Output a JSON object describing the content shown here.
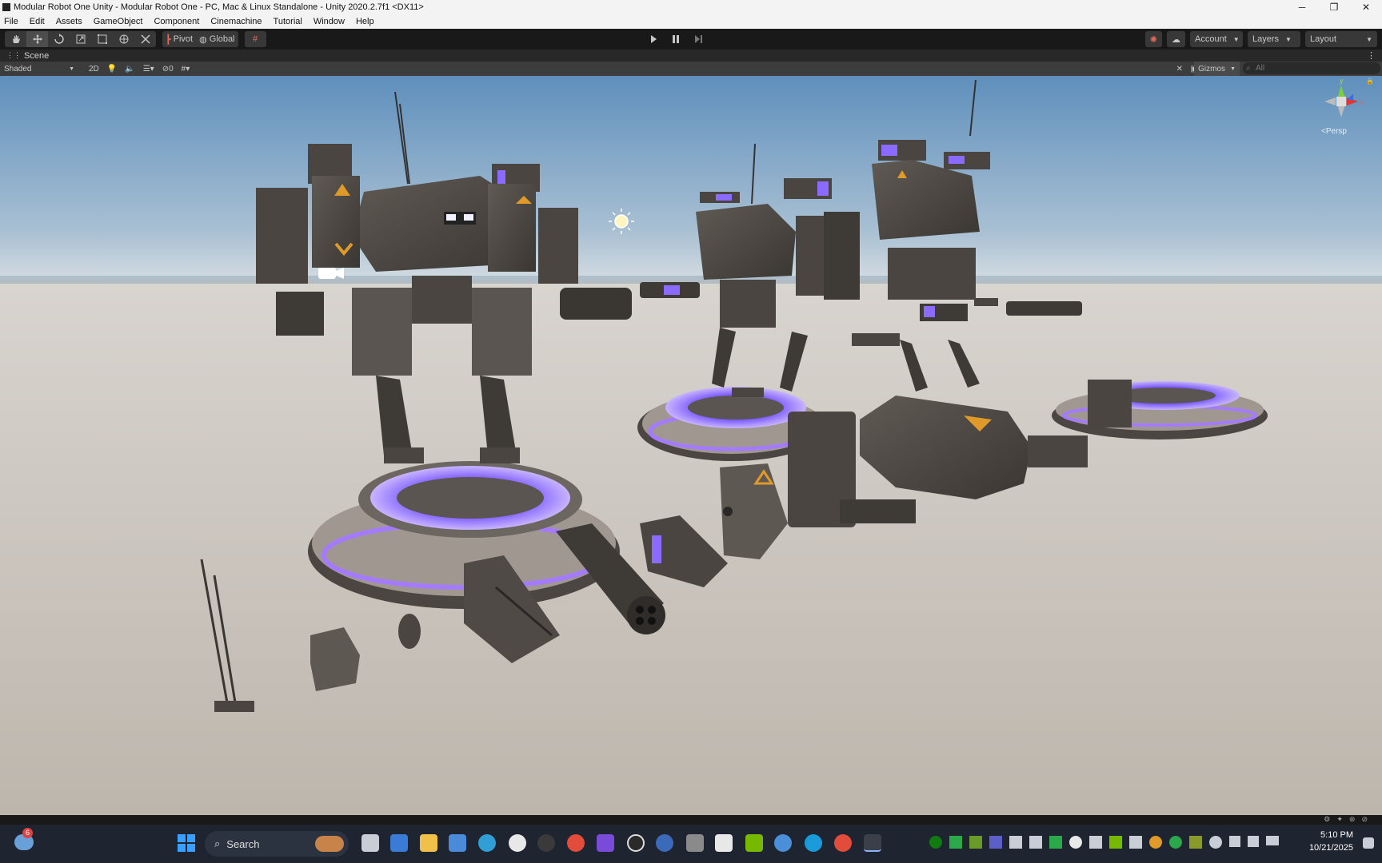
{
  "window": {
    "title": "Modular Robot One Unity - Modular Robot One - PC, Mac & Linux Standalone - Unity 2020.2.7f1 <DX11>",
    "minimize": "─",
    "restore": "❐",
    "close": "✕"
  },
  "menu": [
    "File",
    "Edit",
    "Assets",
    "GameObject",
    "Component",
    "Cinemachine",
    "Tutorial",
    "Window",
    "Help"
  ],
  "toolbar": {
    "pivot": "Pivot",
    "global": "Global",
    "account": "Account",
    "layers": "Layers",
    "layout": "Layout"
  },
  "scene": {
    "tab_label": "Scene",
    "shading_mode": "Shaded",
    "mode_2d": "2D",
    "hidden_count": "0",
    "gizmos": "Gizmos",
    "search_placeholder": "All",
    "persp_label": "<Persp",
    "axis_y": "y",
    "axis_x": "x",
    "axis_z": "z"
  },
  "taskbar": {
    "weather_badge": "6",
    "search_label": "Search",
    "time": "5:10 PM",
    "date": "10/21/2025"
  },
  "colors": {
    "sky_top": "#6f9fc8",
    "sky_horizon": "#c9d6e0",
    "ground": "#c9c3bb",
    "robot_body": "#4a4540",
    "glow": "#9a6cff",
    "accent_orange": "#e09a2a"
  }
}
